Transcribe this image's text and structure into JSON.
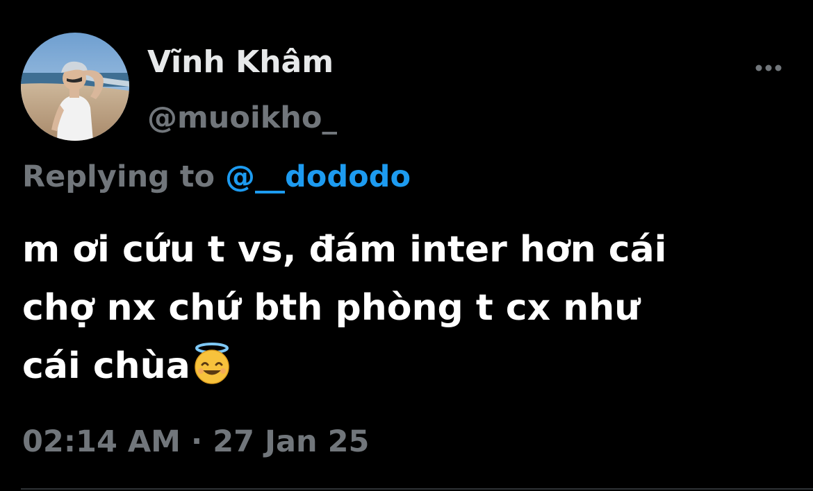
{
  "tweet": {
    "author": {
      "display_name": "Vĩnh Khâm",
      "handle": "@muoikho_"
    },
    "reply": {
      "prefix": "Replying to",
      "mention": "@__dododo"
    },
    "text_line_1": "m ơi cứu t vs, đám inter hơn cái",
    "text_line_2": "chợ nx chứ bth phòng t cx như",
    "text_line_3": "cái chùa",
    "emoji": "smiling-face-with-halo",
    "time": "02:14 AM",
    "separator": "·",
    "date": "27 Jan 25"
  },
  "icons": {
    "more": "more-horizontal-icon"
  },
  "colors": {
    "background": "#000000",
    "text_primary": "#ffffff",
    "text_secondary": "#71767b",
    "accent": "#1d9bf0"
  }
}
